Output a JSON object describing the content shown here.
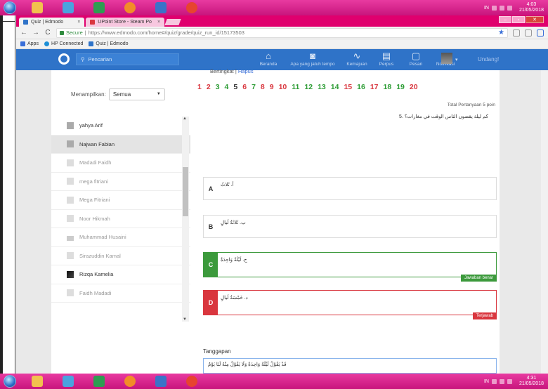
{
  "taskbar_top": {
    "clock_time": "4:03",
    "clock_date": "21/05/2018",
    "apps": [
      {
        "name": "explorer",
        "color": "#f2c14e"
      },
      {
        "name": "media",
        "color": "#4aa3df"
      },
      {
        "name": "excel",
        "color": "#2e9d52"
      },
      {
        "name": "paint",
        "color": "#f28c28"
      },
      {
        "name": "publisher",
        "color": "#3a73c8"
      },
      {
        "name": "chrome",
        "color": "#e7442f"
      }
    ]
  },
  "taskbar_bottom": {
    "clock_time": "4:31",
    "clock_date": "21/05/2018"
  },
  "browser": {
    "tabs": [
      {
        "label": "Quiz | Edmodo",
        "close": "×"
      },
      {
        "label": "UPoint Store - Steam Po",
        "close": "×"
      }
    ],
    "url_secure": "Secure",
    "url": "https://www.edmodo.com/home#/quiz/grade/quiz_run_id/15173503",
    "bookmarks": [
      {
        "label": "Apps"
      },
      {
        "label": "HP Connected"
      },
      {
        "label": "Quiz | Edmodo"
      }
    ]
  },
  "edmodo": {
    "search_placeholder": "Pencarian",
    "nav": [
      {
        "icon": "⌂",
        "label": "Beranda"
      },
      {
        "icon": "◙",
        "label": "Apa yang jatuh tempo"
      },
      {
        "icon": "∿",
        "label": "Kemajuan"
      },
      {
        "icon": "▤",
        "label": "Perpus"
      },
      {
        "icon": "▢",
        "label": "Pesan"
      },
      {
        "icon": "⍝",
        "label": "Notifikasi"
      }
    ],
    "invite": "Undang!"
  },
  "left": {
    "show_label": "Menampilkan:",
    "show_value": "Semua",
    "students": [
      {
        "name": "yahya Arif",
        "state": "done"
      },
      {
        "name": "Najwan Fabian",
        "state": "active"
      },
      {
        "name": "Madadi Faidh",
        "state": "none"
      },
      {
        "name": "mega fitriani",
        "state": "none"
      },
      {
        "name": "Mega Fitriani",
        "state": "none"
      },
      {
        "name": "Noor Hikmah",
        "state": "none"
      },
      {
        "name": "Muhammad Husaini",
        "state": "none"
      },
      {
        "name": "Sirazuddin Kamal",
        "state": "none"
      },
      {
        "name": "Rizqa Kamelia",
        "state": "done"
      },
      {
        "name": "Faidh Madadi",
        "state": "none"
      }
    ]
  },
  "right": {
    "crumb_prefix": "Bertingkat",
    "crumb_sep": "|",
    "crumb_link": "Hapus",
    "question_numbers": [
      {
        "n": "1",
        "s": "wrong"
      },
      {
        "n": "2",
        "s": "wrong"
      },
      {
        "n": "3",
        "s": "ok"
      },
      {
        "n": "4",
        "s": "ok"
      },
      {
        "n": "5",
        "s": "cur"
      },
      {
        "n": "6",
        "s": "wrong"
      },
      {
        "n": "7",
        "s": "ok"
      },
      {
        "n": "8",
        "s": "wrong"
      },
      {
        "n": "9",
        "s": "wrong"
      },
      {
        "n": "10",
        "s": "wrong"
      },
      {
        "n": "11",
        "s": "ok"
      },
      {
        "n": "12",
        "s": "ok"
      },
      {
        "n": "13",
        "s": "ok"
      },
      {
        "n": "14",
        "s": "ok"
      },
      {
        "n": "15",
        "s": "wrong"
      },
      {
        "n": "16",
        "s": "ok"
      },
      {
        "n": "17",
        "s": "wrong"
      },
      {
        "n": "18",
        "s": "ok"
      },
      {
        "n": "19",
        "s": "ok"
      },
      {
        "n": "20",
        "s": "wrong"
      }
    ],
    "total": "Total Pertanyaan 5 poin",
    "question": "كم ليلة يقضون الناس الوقت في مغارات؟ .5",
    "answers": [
      {
        "letter": "A",
        "text": "أ. ثَلاثُ",
        "state": "none"
      },
      {
        "letter": "B",
        "text": "ب. ثَلاثَةُ لَيالٍ",
        "state": "none"
      },
      {
        "letter": "C",
        "text": "ج. لَيْلَةٌ وَاحِدَةٌ",
        "state": "correct",
        "flag": "Jawaban benar"
      },
      {
        "letter": "D",
        "text": "د. خَمْسَةُ لَيالٍ",
        "state": "wrong",
        "flag": "Terjawab"
      }
    ],
    "response_label": "Tanggapan",
    "response_text": "قَدْ يَقُوْلُ لَيْلَةٌ وَاحِدَةٌ وَلَا يَقُوْلُ مِنْهُ لَنَا يَوْمٌ"
  }
}
